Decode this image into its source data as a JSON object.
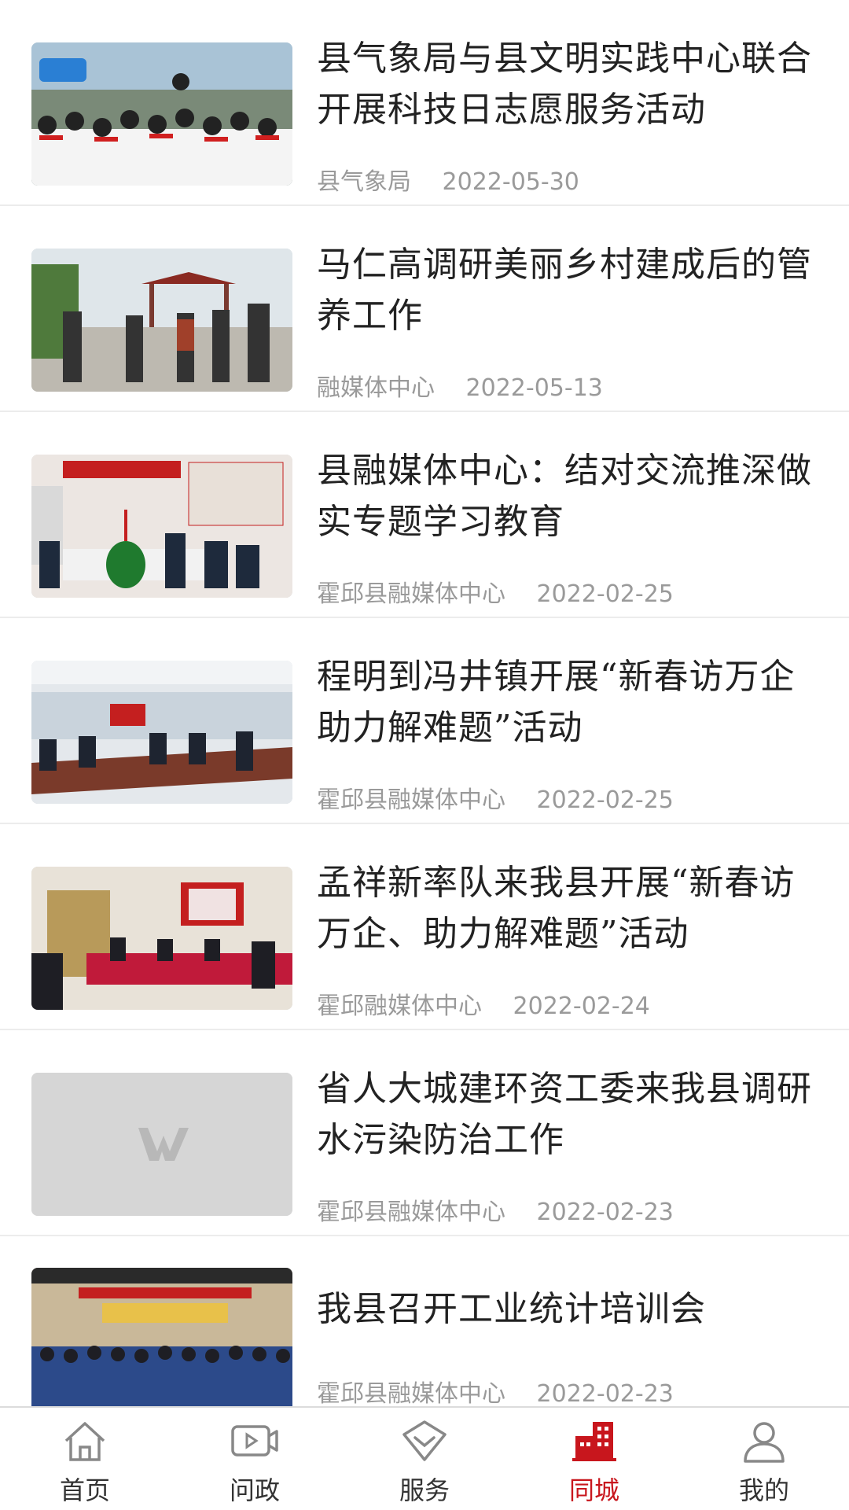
{
  "news": [
    {
      "title": "县气象局与县文明实践中心联合开展科技日志愿服务活动",
      "source": "县气象局",
      "date": "2022-05-30"
    },
    {
      "title": "马仁高调研美丽乡村建成后的管养工作",
      "source": "融媒体中心",
      "date": "2022-05-13"
    },
    {
      "title": "县融媒体中心：结对交流推深做实专题学习教育",
      "source": "霍邱县融媒体中心",
      "date": "2022-02-25"
    },
    {
      "title": "程明到冯井镇开展“新春访万企 助力解难题”活动",
      "source": "霍邱县融媒体中心",
      "date": "2022-02-25"
    },
    {
      "title": "孟祥新率队来我县开展“新春访万企、助力解难题”活动",
      "source": "霍邱融媒体中心",
      "date": "2022-02-24"
    },
    {
      "title": "省人大城建环资工委来我县调研水污染防治工作",
      "source": "霍邱县融媒体中心",
      "date": "2022-02-23"
    },
    {
      "title": "我县召开工业统计培训会",
      "source": "霍邱县融媒体中心",
      "date": "2022-02-23"
    }
  ],
  "tabbar": {
    "home": "首页",
    "wenzheng": "问政",
    "service": "服务",
    "tongcheng": "同城",
    "mine": "我的",
    "active_color": "#c8161d"
  }
}
